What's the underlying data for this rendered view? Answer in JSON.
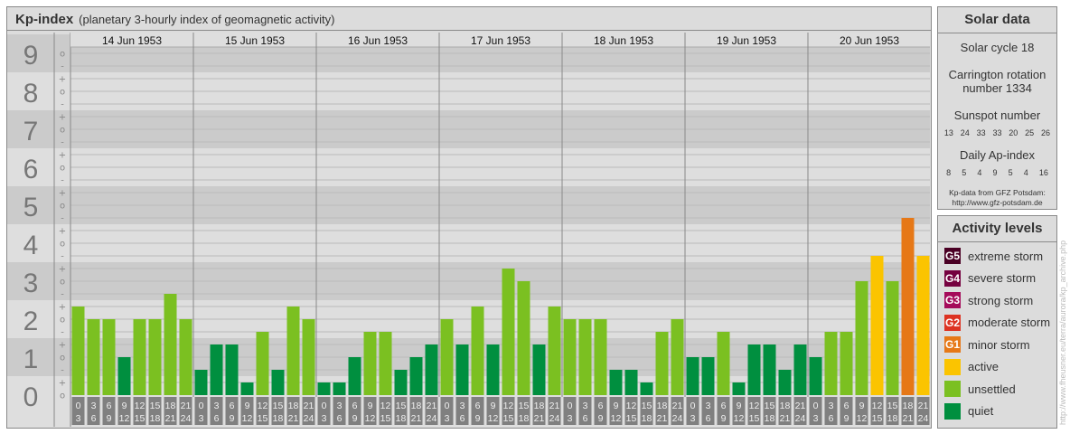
{
  "title": {
    "main": "Kp-index",
    "subtitle": "(planetary 3-hourly index of geomagnetic activity)"
  },
  "chart_data": {
    "type": "bar",
    "title": "Kp-index",
    "ylabel": "Kp",
    "ylim": [
      0,
      9
    ],
    "y_ticks": [
      "0",
      "1",
      "2",
      "3",
      "4",
      "5",
      "6",
      "7",
      "8",
      "9"
    ],
    "minor_tick_labels": [
      "-",
      "o",
      "+"
    ],
    "days": [
      "14 Jun 1953",
      "15 Jun 1953",
      "16 Jun 1953",
      "17 Jun 1953",
      "18 Jun 1953",
      "19 Jun 1953",
      "20 Jun 1953"
    ],
    "intervals": [
      [
        "0",
        "3"
      ],
      [
        "3",
        "6"
      ],
      [
        "6",
        "9"
      ],
      [
        "9",
        "12"
      ],
      [
        "12",
        "15"
      ],
      [
        "15",
        "18"
      ],
      [
        "18",
        "21"
      ],
      [
        "21",
        "24"
      ]
    ],
    "kp": [
      [
        "2+",
        "2o",
        "2o",
        "1o",
        "2o",
        "2o",
        "3-",
        "2o"
      ],
      [
        "1-",
        "1+",
        "1+",
        "0+",
        "2-",
        "1-",
        "2+",
        "2o"
      ],
      [
        "0+",
        "0+",
        "1o",
        "2-",
        "2-",
        "1-",
        "1o",
        "1+"
      ],
      [
        "2o",
        "1+",
        "2+",
        "1+",
        "3+",
        "3o",
        "1+",
        "2+"
      ],
      [
        "2o",
        "2o",
        "2o",
        "1-",
        "1-",
        "0+",
        "2-",
        "2o"
      ],
      [
        "1o",
        "1o",
        "2-",
        "0+",
        "1+",
        "1+",
        "1-",
        "1+"
      ],
      [
        "1o",
        "2-",
        "2-",
        "3o",
        "4-",
        "3o",
        "5-",
        "4-"
      ]
    ]
  },
  "solar": {
    "heading": "Solar data",
    "cycle": "Solar cycle 18",
    "carrington1": "Carrington rotation",
    "carrington2": "number 1334",
    "sunspot_label": "Sunspot number",
    "sunspot": [
      "13",
      "24",
      "33",
      "33",
      "20",
      "25",
      "26"
    ],
    "ap_label": "Daily Ap-index",
    "ap": [
      "8",
      "5",
      "4",
      "9",
      "5",
      "4",
      "16"
    ],
    "credit1": "Kp-data from GFZ Potsdam:",
    "credit2": "http://www.gfz-potsdam.de"
  },
  "levels": {
    "heading": "Activity levels",
    "items": [
      {
        "badge": "G5",
        "label": "extreme storm",
        "color": "#4a0024"
      },
      {
        "badge": "G4",
        "label": "severe storm",
        "color": "#75003f"
      },
      {
        "badge": "G3",
        "label": "strong storm",
        "color": "#a50a5a"
      },
      {
        "badge": "G2",
        "label": "moderate storm",
        "color": "#dd3322"
      },
      {
        "badge": "G1",
        "label": "minor storm",
        "color": "#e67817"
      },
      {
        "badge": "",
        "label": "active",
        "color": "#fbc400"
      },
      {
        "badge": "",
        "label": "unsettled",
        "color": "#7bc021"
      },
      {
        "badge": "",
        "label": "quiet",
        "color": "#008f3f"
      }
    ]
  },
  "watermark": "http://www.fheusner.eu/terra/aurora/kp_archive.php"
}
